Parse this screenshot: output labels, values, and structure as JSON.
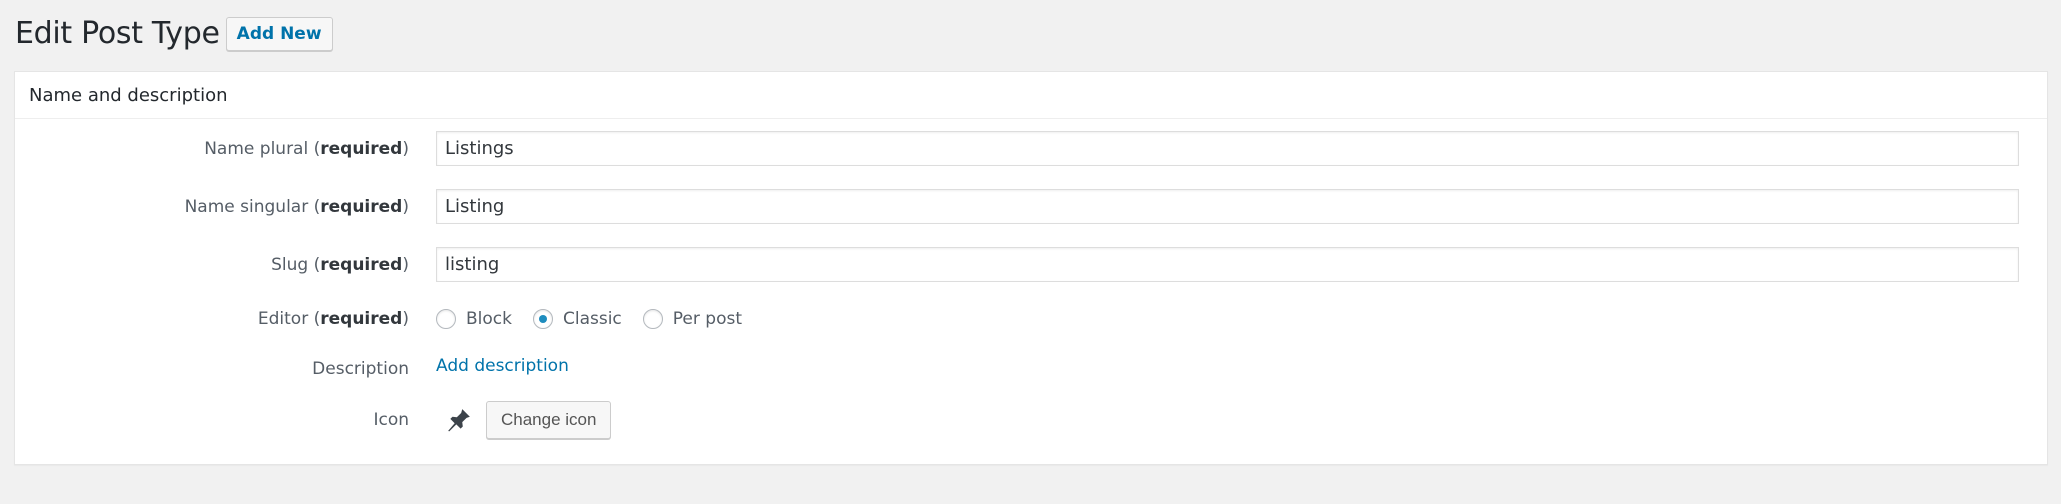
{
  "page": {
    "title": "Edit Post Type",
    "add_new_label": "Add New"
  },
  "postbox": {
    "title": "Name and description"
  },
  "fields": {
    "name_plural": {
      "label": "Name plural",
      "required": "required",
      "value": "Listings"
    },
    "name_singular": {
      "label": "Name singular",
      "required": "required",
      "value": "Listing"
    },
    "slug": {
      "label": "Slug",
      "required": "required",
      "value": "listing"
    },
    "editor": {
      "label": "Editor",
      "required": "required",
      "options": [
        "Block",
        "Classic",
        "Per post"
      ],
      "selected": "Classic"
    },
    "description": {
      "label": "Description",
      "link": "Add description"
    },
    "icon": {
      "label": "Icon",
      "icon_name": "pin-icon",
      "button": "Change icon"
    }
  },
  "colors": {
    "accent": "#0073aa",
    "radio_checked": "#1e8cbe",
    "background": "#f1f1f1"
  }
}
